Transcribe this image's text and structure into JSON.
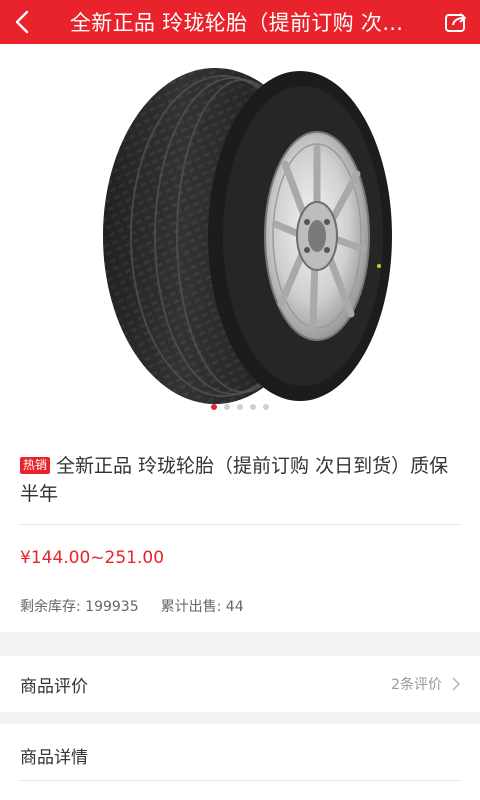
{
  "header": {
    "title": "全新正品 玲珑轮胎（提前订购 次日到货）质保半年",
    "back_icon": "chevron-left-icon",
    "share_icon": "share-icon",
    "background": "#e8232b"
  },
  "gallery": {
    "image_name": "tire-photo",
    "dot_count": 5,
    "active_dot_index": 0
  },
  "product": {
    "badge": "热销",
    "title": "全新正品 玲珑轮胎（提前订购 次日到货）质保半年",
    "price": "¥144.00~251.00",
    "stock_label": "剩余库存: 199935",
    "sold_label": "累计出售: 44",
    "accent_color": "#e8232b"
  },
  "reviews": {
    "label": "商品评价",
    "count_text": "2条评价"
  },
  "details": {
    "label": "商品详情"
  }
}
